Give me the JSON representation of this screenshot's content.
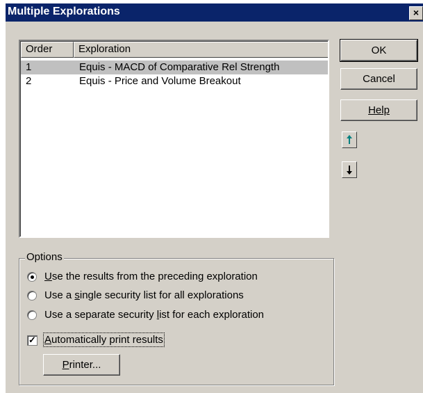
{
  "window": {
    "title": "Multiple Explorations",
    "close_glyph": "×"
  },
  "list": {
    "columns": [
      "Order",
      "Exploration"
    ],
    "rows": [
      {
        "order": "1",
        "exploration": "Equis - MACD of Comparative Rel Strength",
        "selected": true
      },
      {
        "order": "2",
        "exploration": "Equis - Price and Volume Breakout",
        "selected": false
      }
    ]
  },
  "buttons": {
    "ok": "OK",
    "cancel": "Cancel",
    "help": "Help",
    "move_up_icon": "arrow-up-icon",
    "move_down_icon": "arrow-down-icon"
  },
  "options": {
    "legend": "Options",
    "radios": [
      {
        "label": "Use the results from the preceding exploration",
        "checked": true
      },
      {
        "label": "Use a single security list for all explorations",
        "checked": false
      },
      {
        "label": "Use a separate security list for each exploration",
        "checked": false
      }
    ],
    "auto_print": {
      "label": "Automatically print results",
      "checked": true
    },
    "printer_button": "Printer..."
  }
}
